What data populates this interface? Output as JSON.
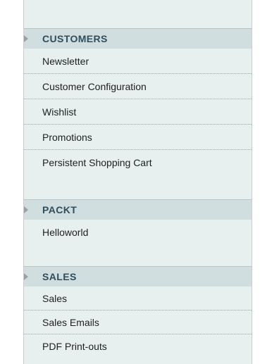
{
  "sections": [
    {
      "title": "CUSTOMERS",
      "items": [
        {
          "label": "Newsletter"
        },
        {
          "label": "Customer Configuration"
        },
        {
          "label": "Wishlist"
        },
        {
          "label": "Promotions"
        },
        {
          "label": "Persistent Shopping Cart"
        }
      ]
    },
    {
      "title": "PACKT",
      "items": [
        {
          "label": "Helloworld"
        }
      ]
    },
    {
      "title": "SALES",
      "items": [
        {
          "label": "Sales"
        },
        {
          "label": "Sales Emails"
        },
        {
          "label": "PDF Print-outs"
        }
      ]
    }
  ],
  "colors": {
    "panel_bg": "#e7efef",
    "header_bg": "#d1dedf",
    "header_text": "#2f4d5a",
    "arrow": "#93a3a8"
  },
  "icons": {
    "section_arrow": "triangle-right-icon"
  }
}
